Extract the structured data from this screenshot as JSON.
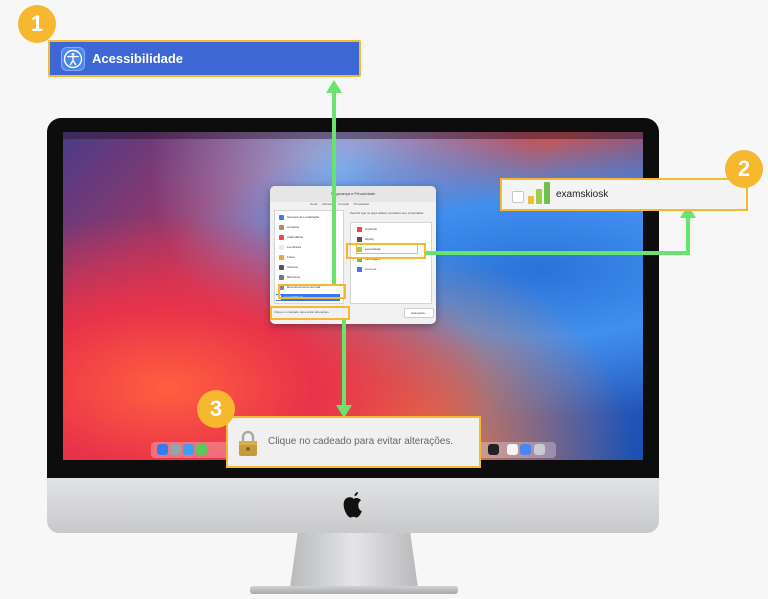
{
  "callouts": {
    "one": {
      "badge": "1",
      "label": "Acessibilidade",
      "icon": "accessibility-icon"
    },
    "two": {
      "badge": "2",
      "label": "examskiosk",
      "icon": "examskiosk-app-icon"
    },
    "three": {
      "badge": "3",
      "label": "Clique no cadeado para evitar alterações.",
      "icon": "lock-icon"
    }
  },
  "colors": {
    "accent": "#f5b82e",
    "arrow": "#68e46e",
    "selection_blue": "#3e67d6"
  },
  "screen": {
    "window": {
      "title": "Segurança e Privacidade",
      "tabs": [
        "Geral",
        "FileVault",
        "Firewall",
        "Privacidade"
      ],
      "description": "Permitir que os apps abaixo controlem seu computador.",
      "sidebar_items": [
        {
          "label": "Serviços de Localização",
          "color": "#3a7cf0"
        },
        {
          "label": "Contatos",
          "color": "#b9885a"
        },
        {
          "label": "Calendários",
          "color": "#ef4b40"
        },
        {
          "label": "Lembretes",
          "color": "#e9e9e9"
        },
        {
          "label": "Fotos",
          "color": "#f1a33a"
        },
        {
          "label": "Câmera",
          "color": "#555555"
        },
        {
          "label": "Microfone",
          "color": "#777777"
        },
        {
          "label": "Reconhecimento de Fala",
          "color": "#888888"
        },
        {
          "label": "Acessibilidade",
          "color": "#3a7cf0"
        }
      ],
      "list_items": [
        {
          "label": "AnyDesk",
          "color": "#ef4b40"
        },
        {
          "label": "airplay",
          "color": "#555555"
        },
        {
          "label": "examskiosk",
          "color": "#9bd14a"
        },
        {
          "label": "Mensagens",
          "color": "#4ac96e"
        },
        {
          "label": "zoom.us",
          "color": "#3a7cf0"
        }
      ],
      "bottom_text": "Clique no cadeado para evitar alterações.",
      "button": "Avançado..."
    }
  }
}
